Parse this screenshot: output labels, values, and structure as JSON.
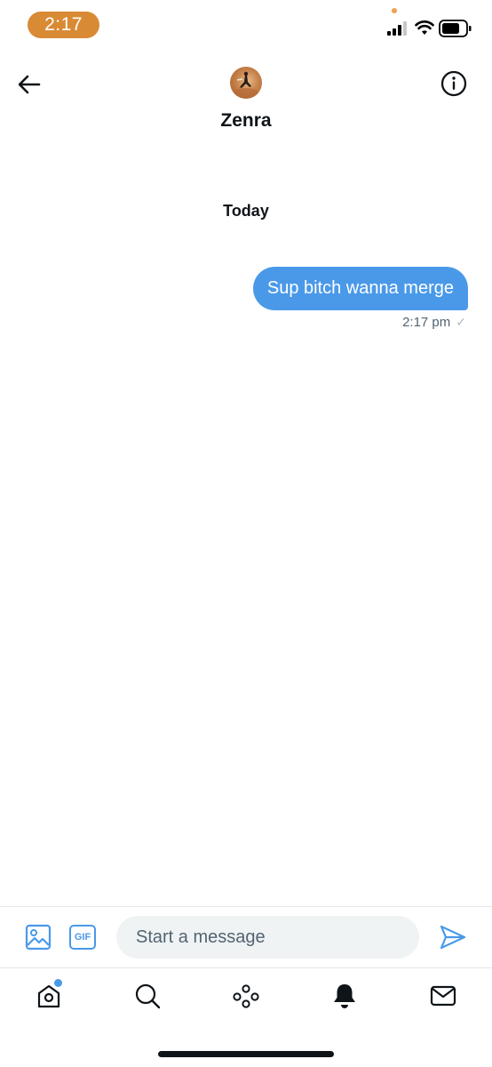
{
  "status_bar": {
    "time": "2:17"
  },
  "header": {
    "contact_name": "Zenra",
    "back_icon": "arrow-left-icon",
    "info_icon": "info-icon"
  },
  "conversation": {
    "date_divider": "Today",
    "messages": [
      {
        "text": "Sup bitch wanna merge",
        "time": "2:17 pm",
        "status": "✓",
        "direction": "outgoing"
      }
    ]
  },
  "composer": {
    "placeholder": "Start a message",
    "gif_label": "GIF",
    "media_icon": "image-icon",
    "send_icon": "send-icon"
  },
  "tab_bar": {
    "tabs": [
      {
        "name": "home",
        "icon": "home-icon",
        "has_badge": true
      },
      {
        "name": "search",
        "icon": "search-icon"
      },
      {
        "name": "spaces",
        "icon": "spaces-icon"
      },
      {
        "name": "notifications",
        "icon": "bell-icon"
      },
      {
        "name": "messages",
        "icon": "mail-icon"
      }
    ]
  },
  "colors": {
    "accent": "#4a99e9",
    "time_pill": "#d98a34",
    "text": "#0f1419",
    "muted": "#536471"
  }
}
